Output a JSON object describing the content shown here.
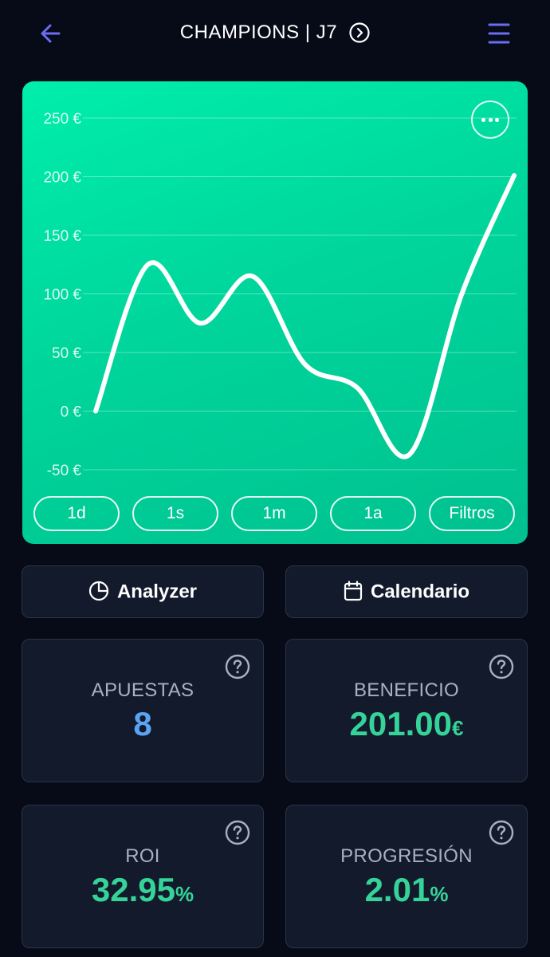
{
  "header": {
    "title": "CHAMPIONS | J7",
    "back_icon": "arrow-left-icon",
    "menu_icon": "hamburger-menu-icon",
    "title_icon": "chevron-right-circle-icon",
    "accent_color": "#6b6cf0"
  },
  "chart_data": {
    "type": "line",
    "y_ticks": [
      "250 €",
      "200 €",
      "150 €",
      "100 €",
      "50 €",
      "0 €",
      "-50 €"
    ],
    "ylim": [
      -50,
      250
    ],
    "series": [
      {
        "x": [
          0,
          1,
          2,
          3,
          4,
          5,
          6,
          7,
          8
        ],
        "values": [
          0,
          125,
          75,
          115,
          40,
          20,
          -37,
          100,
          201
        ]
      }
    ],
    "line_color": "#ffffff",
    "background_color": "#00d69c",
    "grid": true
  },
  "chart": {
    "more_icon": "more-horizontal-icon",
    "periods": [
      "1d",
      "1s",
      "1m",
      "1a",
      "Filtros"
    ]
  },
  "actions": {
    "analyzer": {
      "label": "Analyzer",
      "icon": "pie-chart-icon"
    },
    "calendar": {
      "label": "Calendario",
      "icon": "calendar-icon"
    }
  },
  "stats": {
    "apuestas": {
      "label": "APUESTAS",
      "value": "8",
      "unit": "",
      "color": "#5aa3f5"
    },
    "beneficio": {
      "label": "BENEFICIO",
      "value": "201.00",
      "unit": "€",
      "color": "#36d399"
    },
    "roi": {
      "label": "ROI",
      "value": "32.95",
      "unit": "%",
      "color": "#36d399"
    },
    "progresion": {
      "label": "PROGRESIÓN",
      "value": "2.01",
      "unit": "%",
      "color": "#36d399"
    },
    "help_icon": "question-circle-icon"
  }
}
